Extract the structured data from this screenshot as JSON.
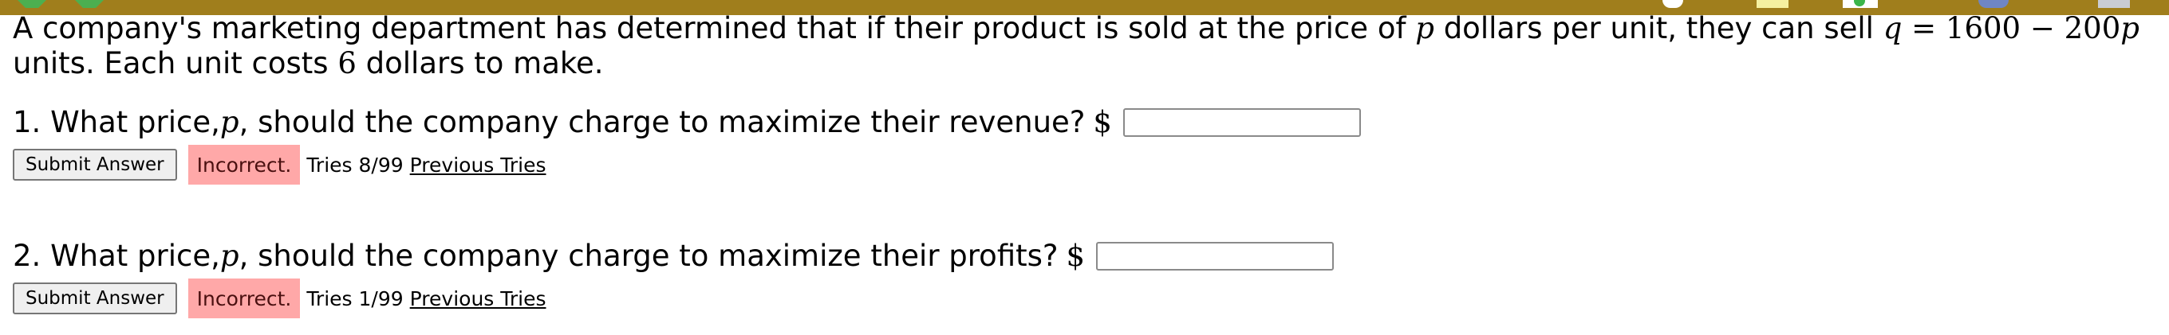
{
  "toolbar": {
    "icons": [
      "back-arrow-icon",
      "forward-arrow-icon",
      "circle-icon",
      "note-icon",
      "status-icon",
      "globe-icon",
      "trash-icon"
    ],
    "bar_color": "#a07e1c"
  },
  "problem": {
    "text_1": "A company's marketing department has determined that if their product is sold at the price of ",
    "var_p": "p",
    "text_2": " dollars per unit, they can sell ",
    "equation_q": "q",
    "equation_eq": " = ",
    "equation_value": "1600 − 200",
    "equation_p": "p",
    "text_3": "units. Each unit costs ",
    "cost": "6",
    "text_4": " dollars to make."
  },
  "questions": [
    {
      "prefix": "1. What price, ",
      "var": "p",
      "suffix": ", should the company charge to maximize their revenue?",
      "currency": "$",
      "value": "",
      "submit_label": "Submit Answer",
      "status": "Incorrect.",
      "tries": "Tries 8/99",
      "previous_label": "Previous Tries"
    },
    {
      "prefix": "2. What price, ",
      "var": "p",
      "suffix": ", should the company charge to maximize their profits?",
      "currency": "$",
      "value": "",
      "submit_label": "Submit Answer",
      "status": "Incorrect.",
      "tries": "Tries 1/99",
      "previous_label": "Previous Tries"
    }
  ],
  "colors": {
    "incorrect_bg": "#ffa8a8"
  }
}
